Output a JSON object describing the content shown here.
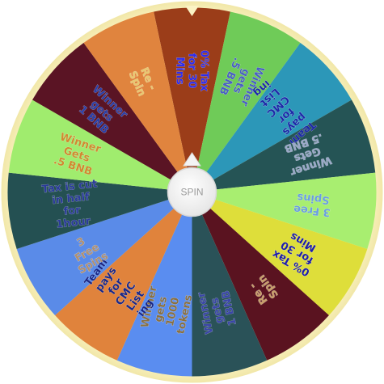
{
  "spin_button": {
    "label": "SPIN"
  },
  "wheel": {
    "rim_color": "#fbf3c4",
    "segments": [
      {
        "lines": [
          "0% Tax",
          "for 30",
          "Mins"
        ],
        "color": "#9b3d19",
        "text_color": "#2d2df0"
      },
      {
        "lines": [
          "Winner",
          "gets",
          ".5 BNB"
        ],
        "color": "#6fcb58",
        "text_color": "#4a5fc4"
      },
      {
        "lines": [
          "Team",
          "pays",
          "for",
          "CMC",
          "List",
          "ing"
        ],
        "color": "#2c97b8",
        "text_color": "#1e2aa8"
      },
      {
        "lines": [
          "Winner",
          "Gets",
          ".5 BNB"
        ],
        "color": "#255455",
        "text_color": "#9aa8c8"
      },
      {
        "lines": [
          "3 Free",
          "Spins"
        ],
        "color": "#a8ee70",
        "text_color": "#6a9ee0"
      },
      {
        "lines": [
          "0% Tax",
          "for 30",
          "Mins"
        ],
        "color": "#dede3a",
        "text_color": "#1e1ea8"
      },
      {
        "lines": [
          "Re -",
          "Spin"
        ],
        "color": "#5a1320",
        "text_color": "#c8a06a"
      },
      {
        "lines": [
          "Winner",
          "gets",
          "1 BNB"
        ],
        "color": "#2a5258",
        "text_color": "#3a45a8"
      },
      {
        "lines": [
          "Winner",
          "gets",
          "1000",
          "tokens"
        ],
        "color": "#5a8df0",
        "text_color": "#8a7040"
      },
      {
        "lines": [
          "Team",
          "pays",
          "for",
          "CMC",
          "List",
          "ing"
        ],
        "color": "#e0833c",
        "text_color": "#1a2888"
      },
      {
        "lines": [
          "3",
          "Free",
          "Spins"
        ],
        "color": "#5a8be8",
        "text_color": "#b09070"
      },
      {
        "lines": [
          "Tax is cut",
          "in half",
          "for",
          "1hour"
        ],
        "color": "#245052",
        "text_color": "#2a3a9a"
      },
      {
        "lines": [
          "Winner",
          "Gets",
          ".5 BNB"
        ],
        "color": "#a0ec6e",
        "text_color": "#d08a30"
      },
      {
        "lines": [
          "Winner",
          "gets",
          "1 BNB"
        ],
        "color": "#5a1424",
        "text_color": "#2a3fa8"
      },
      {
        "lines": [
          "Re -",
          "Spin"
        ],
        "color": "#e0843e",
        "text_color": "#e8c870"
      }
    ]
  }
}
